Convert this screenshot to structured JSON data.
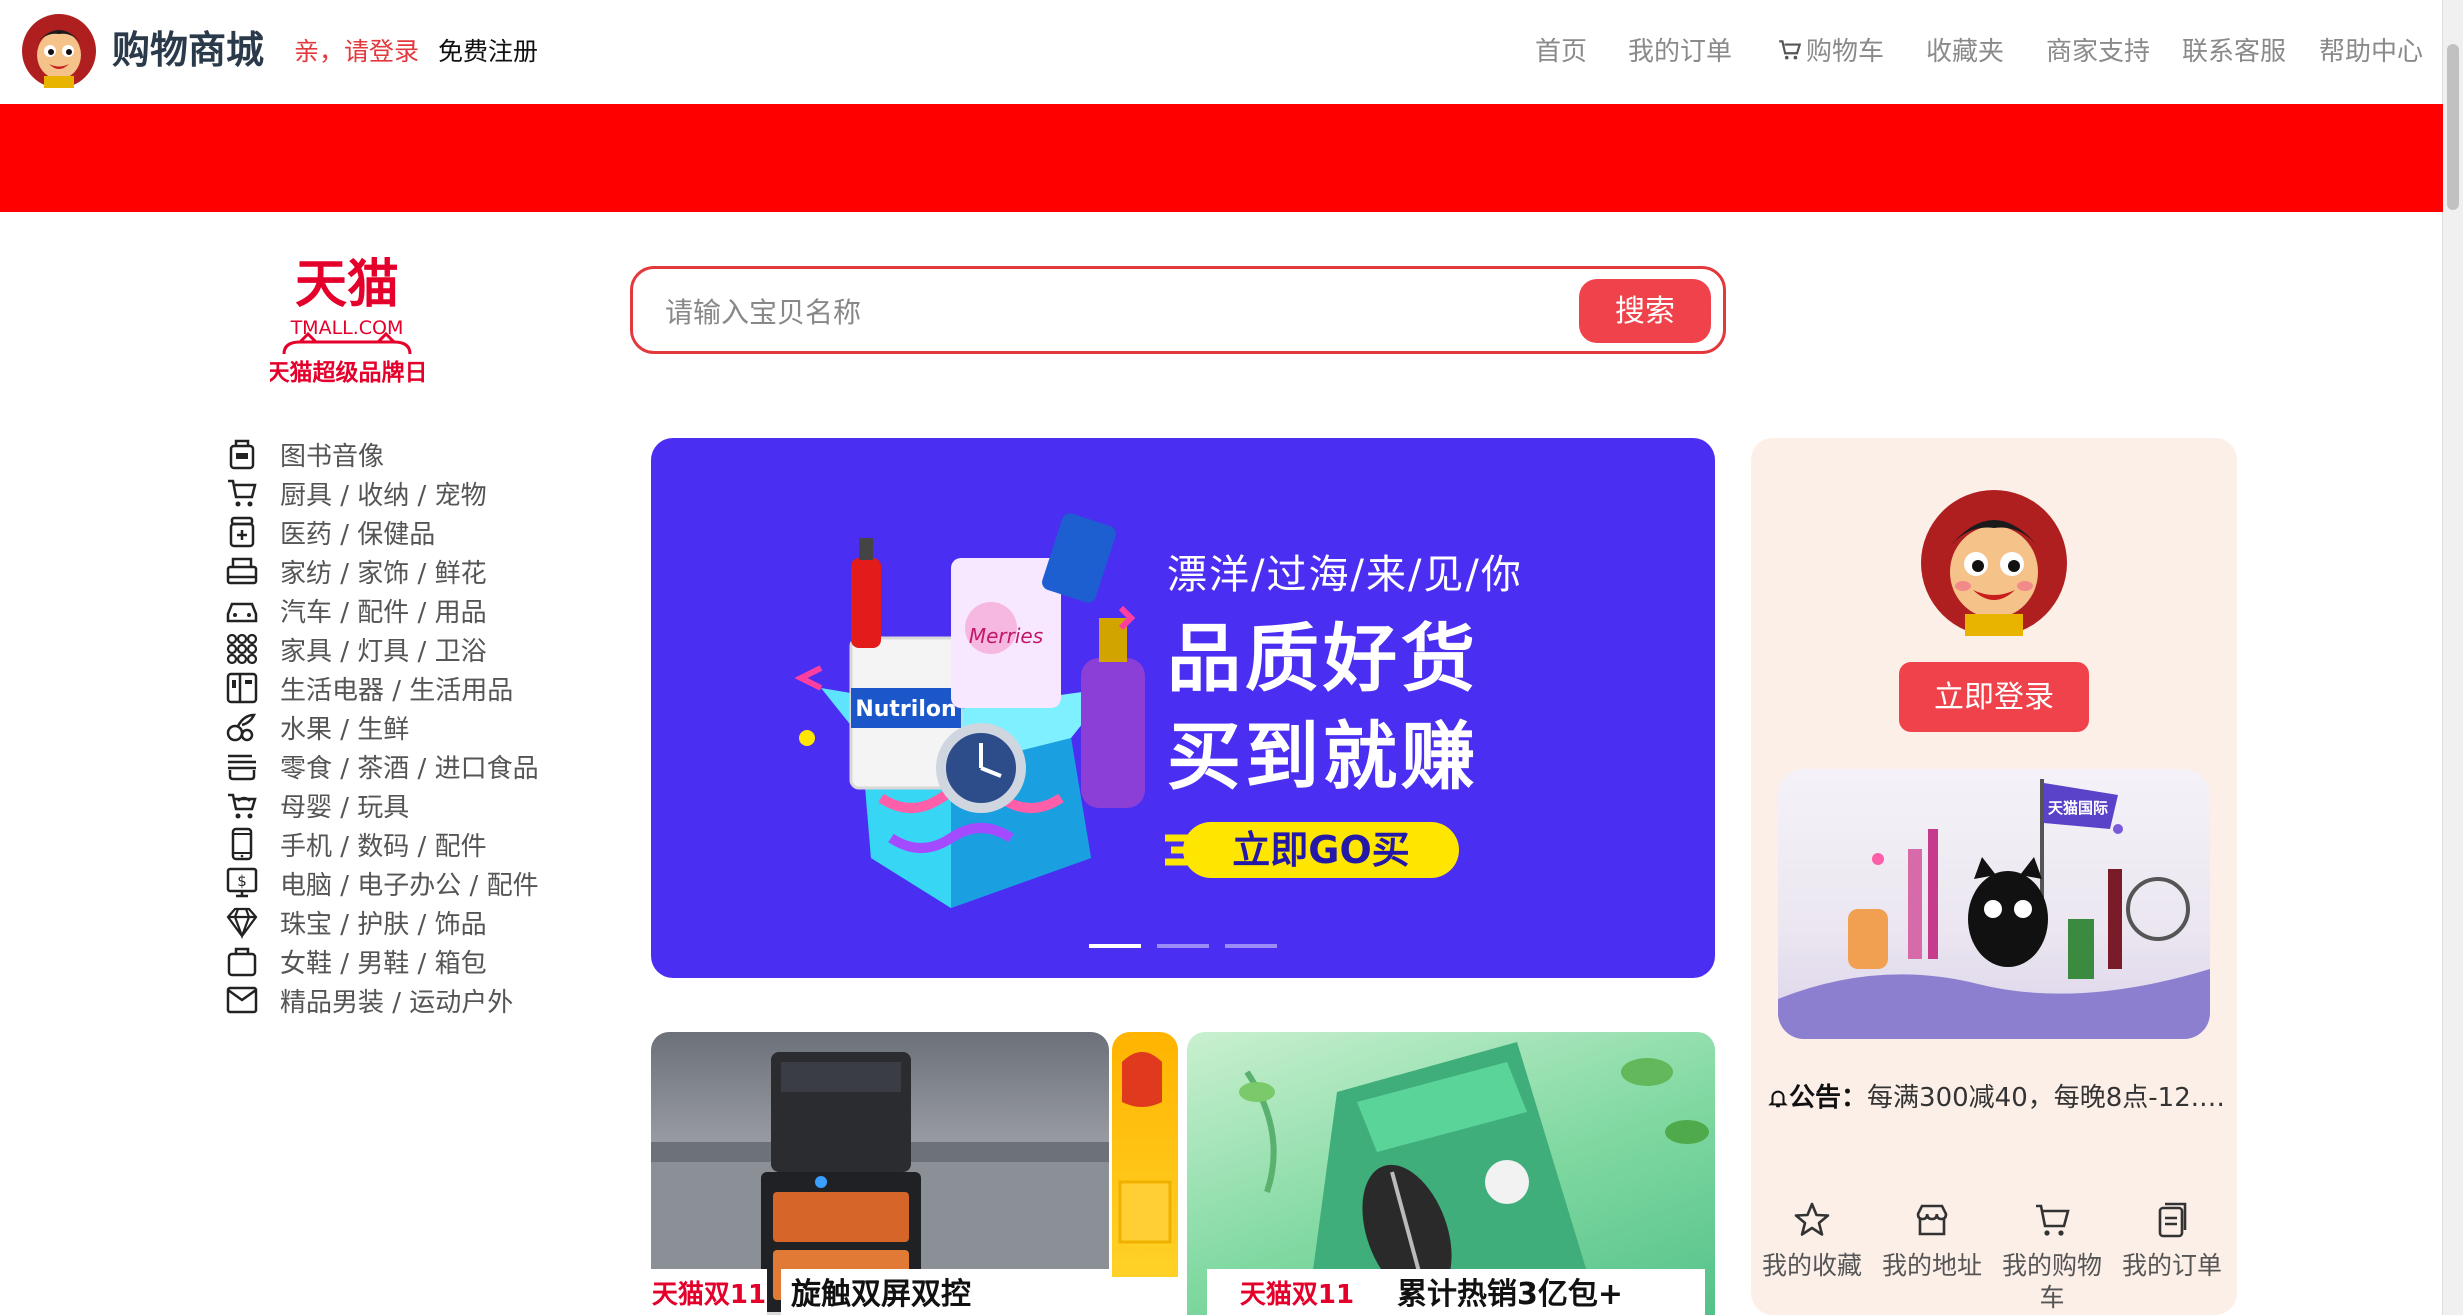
{
  "header": {
    "brand": "购物商城",
    "login_link": "亲，请登录",
    "register_link": "免费注册",
    "nav": [
      "首页",
      "我的订单",
      "购物车",
      "收藏夹",
      "商家支持",
      "联系客服",
      "帮助中心"
    ]
  },
  "search": {
    "placeholder": "请输入宝贝名称",
    "button": "搜索"
  },
  "tmall_logo": {
    "text": "天猫",
    "domain": "TMALL.COM",
    "tagline": "天猫超级品牌日"
  },
  "categories": [
    {
      "label": "图书音像",
      "icon": "book-icon"
    },
    {
      "label": "厨具 / 收纳 / 宠物",
      "icon": "cart-icon"
    },
    {
      "label": "医药 / 保健品",
      "icon": "medicine-icon"
    },
    {
      "label": "家纺 / 家饰 / 鲜花",
      "icon": "home-textile-icon"
    },
    {
      "label": "汽车 / 配件 / 用品",
      "icon": "car-icon"
    },
    {
      "label": "家具 / 灯具 / 卫浴",
      "icon": "grid-icon"
    },
    {
      "label": "生活电器 / 生活用品",
      "icon": "appliance-icon"
    },
    {
      "label": "水果 / 生鲜",
      "icon": "fruit-icon"
    },
    {
      "label": "零食 / 茶酒 / 进口食品",
      "icon": "snack-icon"
    },
    {
      "label": "母婴 / 玩具",
      "icon": "stroller-icon"
    },
    {
      "label": "手机 / 数码 / 配件",
      "icon": "phone-icon"
    },
    {
      "label": "电脑 / 电子办公 / 配件",
      "icon": "computer-icon"
    },
    {
      "label": "珠宝 / 护肤 / 饰品",
      "icon": "diamond-icon"
    },
    {
      "label": "女鞋 / 男鞋 / 箱包",
      "icon": "bag-icon"
    },
    {
      "label": "精品男装 / 运动户外",
      "icon": "clothing-icon"
    }
  ],
  "banner": {
    "subtitle": "漂洋/过海/来/见/你",
    "headline_1": "品质好货",
    "headline_2": "买到就赚",
    "cta": "立即GO买",
    "product_labels": [
      "Nutrilon",
      "Merries"
    ],
    "slide_count": 3,
    "active_slide": 0
  },
  "promo_cards": [
    {
      "tag": "天猫双11",
      "title": "旋触双屏双控"
    },
    {
      "tag": "",
      "title": ""
    },
    {
      "tag": "天猫双11",
      "title": "累计热销3亿包+"
    }
  ],
  "panel": {
    "login_button": "立即登录",
    "notice_label": "公告",
    "notice_text": "每满300减40，每晚8点-12.1...",
    "image_flag": "天猫国际",
    "quick_links": [
      {
        "label": "我的收藏",
        "icon": "star-icon"
      },
      {
        "label": "我的地址",
        "icon": "store-icon"
      },
      {
        "label": "我的购物车",
        "icon": "shopping-cart-icon"
      },
      {
        "label": "我的订单",
        "icon": "order-icon"
      }
    ]
  },
  "colors": {
    "accent": "#e4393c",
    "red_bar": "#ff0000",
    "banner_bg": "#4a2ef2",
    "cta_yellow": "#ffe600",
    "panel_bg": "#fbefe8"
  }
}
